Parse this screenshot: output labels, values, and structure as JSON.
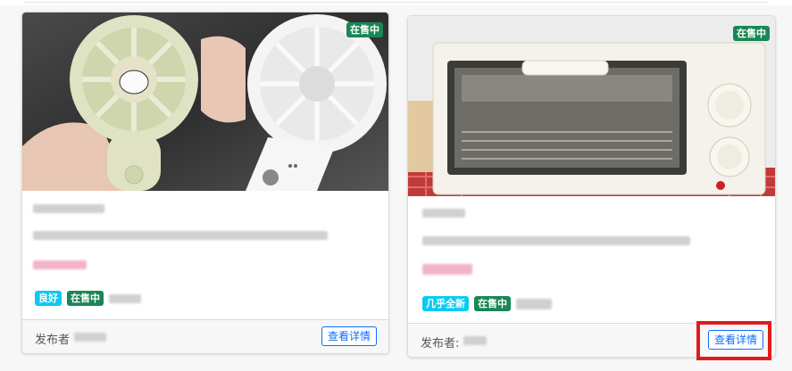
{
  "cards": [
    {
      "status_badge": "在售中",
      "condition_tag": "良好",
      "status_tag": "在售中",
      "poster_label": "发布者",
      "detail_button": "查看详情"
    },
    {
      "status_badge": "在售中",
      "condition_tag": "几乎全新",
      "status_tag": "在售中",
      "poster_label": "发布者:",
      "detail_button": "查看详情"
    }
  ],
  "colors": {
    "success": "#198754",
    "info": "#0dcaf0",
    "primary": "#0d6efd",
    "highlight": "#e31b1b"
  }
}
